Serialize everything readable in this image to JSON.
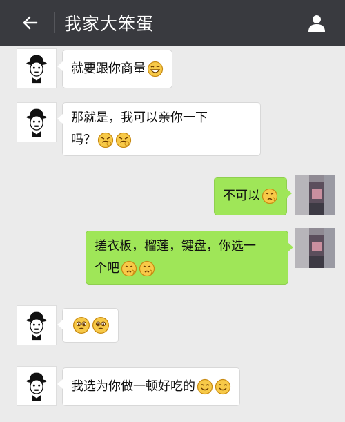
{
  "header": {
    "title": "我家大笨蛋",
    "back_icon": "arrow-left-icon",
    "profile_icon": "person-icon",
    "bg_color": "#393a3f"
  },
  "messages": [
    {
      "side": "left",
      "text": "就要跟你商量",
      "emojis": [
        "grin-emoji"
      ]
    },
    {
      "side": "left",
      "text_line1": "那就是，我可以亲你一下",
      "text_line2": "吗？",
      "emojis": [
        "grimace-emoji",
        "grimace-emoji"
      ]
    },
    {
      "side": "right",
      "text": "不可以",
      "emojis": [
        "thinking-emoji"
      ]
    },
    {
      "side": "right",
      "text_line1": "搓衣板，榴莲，键盘，你选一",
      "text_line2": "个吧",
      "emojis": [
        "thinking-emoji",
        "thinking-emoji"
      ]
    },
    {
      "side": "left",
      "text": "",
      "emojis": [
        "teary-emoji",
        "teary-emoji"
      ]
    },
    {
      "side": "left",
      "text": "我选为你做一顿好吃的",
      "emojis": [
        "smile-emoji",
        "smile-emoji"
      ]
    }
  ],
  "colors": {
    "incoming": "#ffffff",
    "outgoing": "#9fe658",
    "background": "#ebebeb"
  }
}
